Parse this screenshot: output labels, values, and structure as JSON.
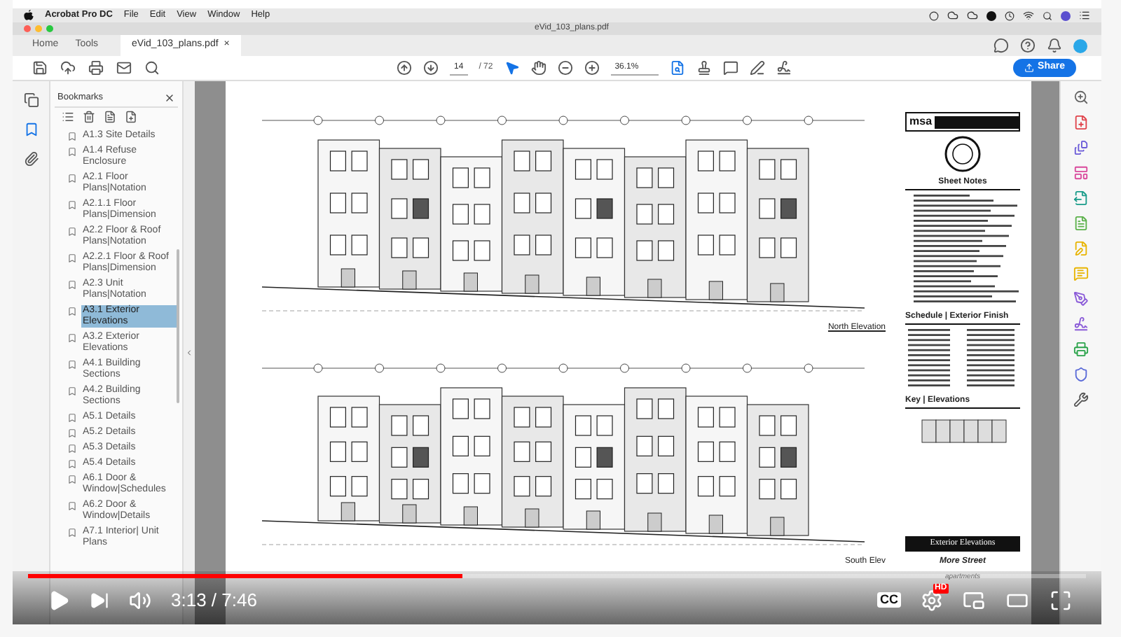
{
  "menu_bar": {
    "app": "Acrobat Pro DC",
    "items": [
      "File",
      "Edit",
      "View",
      "Window",
      "Help"
    ]
  },
  "window": {
    "title": "eVid_103_plans.pdf"
  },
  "tabs": [
    {
      "label": "Home",
      "selected": false
    },
    {
      "label": "Tools",
      "selected": false
    },
    {
      "label": "eVid_103_plans.pdf",
      "selected": true,
      "close": "×"
    }
  ],
  "toolbar": {
    "page": "14",
    "page_total": "/ 72",
    "zoom": "36.1%",
    "share": "Share"
  },
  "bookmarks": {
    "title": "Bookmarks",
    "items": [
      {
        "label": "A1.3 Site Details",
        "selected": false
      },
      {
        "label": "A1.4 Refuse Enclosure",
        "selected": false
      },
      {
        "label": "A2.1 Floor Plans|Notation",
        "selected": false
      },
      {
        "label": "A2.1.1 Floor Plans|Dimension",
        "selected": false
      },
      {
        "label": "A2.2 Floor & Roof Plans|Notation",
        "selected": false
      },
      {
        "label": "A2.2.1 Floor & Roof Plans|Dimension",
        "selected": false
      },
      {
        "label": "A2.3 Unit Plans|Notation",
        "selected": false
      },
      {
        "label": "A3.1 Exterior Elevations",
        "selected": true
      },
      {
        "label": "A3.2 Exterior Elevations",
        "selected": false
      },
      {
        "label": "A4.1 Building Sections",
        "selected": false
      },
      {
        "label": "A4.2 Building Sections",
        "selected": false
      },
      {
        "label": "A5.1 Details",
        "selected": false
      },
      {
        "label": "A5.2 Details",
        "selected": false
      },
      {
        "label": "A5.3 Details",
        "selected": false
      },
      {
        "label": "A5.4 Details",
        "selected": false
      },
      {
        "label": "A6.1 Door & Window|Schedules",
        "selected": false
      },
      {
        "label": "A6.2 Door & Window|Details",
        "selected": false
      },
      {
        "label": "A7.1 Interior| Unit Plans",
        "selected": false
      }
    ]
  },
  "document": {
    "north_label": "North Elevation",
    "south_label": "South Elev",
    "sheet": {
      "logo": "msa",
      "notes_title": "Sheet Notes",
      "schedule_title": "Schedule | Exterior Finish",
      "key_title": "Key | Elevations",
      "sheet_title": "Exterior Elevations",
      "project": "More Street",
      "project_sub": "apartments"
    }
  },
  "player": {
    "level": 0.41,
    "time": "3:13 / 7:46",
    "cc": "CC",
    "hd": "HD"
  }
}
